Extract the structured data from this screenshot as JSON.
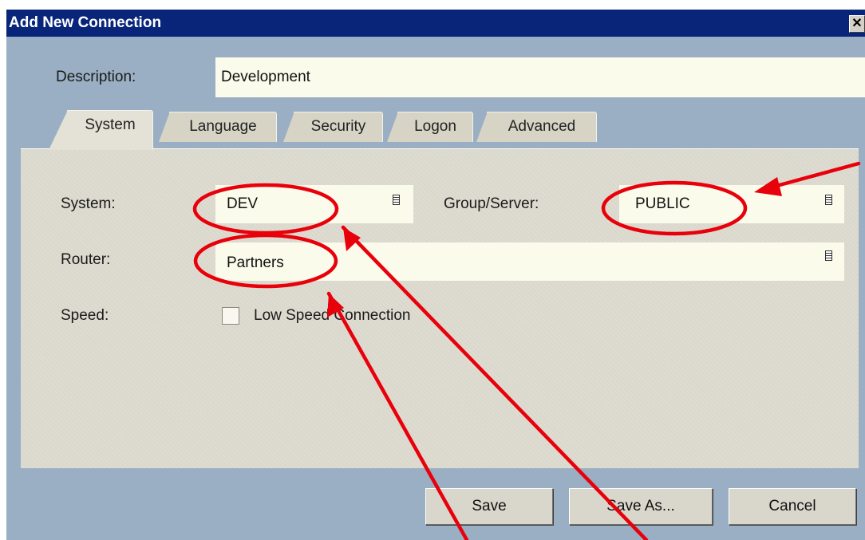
{
  "window": {
    "title": "Add New Connection",
    "close_glyph": "✕"
  },
  "description": {
    "label": "Description:",
    "value": "Development"
  },
  "tabs": [
    {
      "label": "System",
      "active": true
    },
    {
      "label": "Language",
      "active": false
    },
    {
      "label": "Security",
      "active": false
    },
    {
      "label": "Logon",
      "active": false
    },
    {
      "label": "Advanced",
      "active": false
    }
  ],
  "system_tab": {
    "system_label": "System:",
    "system_value": "DEV",
    "group_label": "Group/Server:",
    "group_value": "PUBLIC",
    "router_label": "Router:",
    "router_value": "Partners",
    "speed_label": "Speed:",
    "low_speed_label": "Low Speed Connection",
    "low_speed_checked": false
  },
  "buttons": {
    "save": "Save",
    "save_as": "Save As...",
    "cancel": "Cancel"
  },
  "annotation_color": "#e8000b",
  "icons": {
    "dropdown": "dropdown-list-icon",
    "close": "close-icon"
  }
}
